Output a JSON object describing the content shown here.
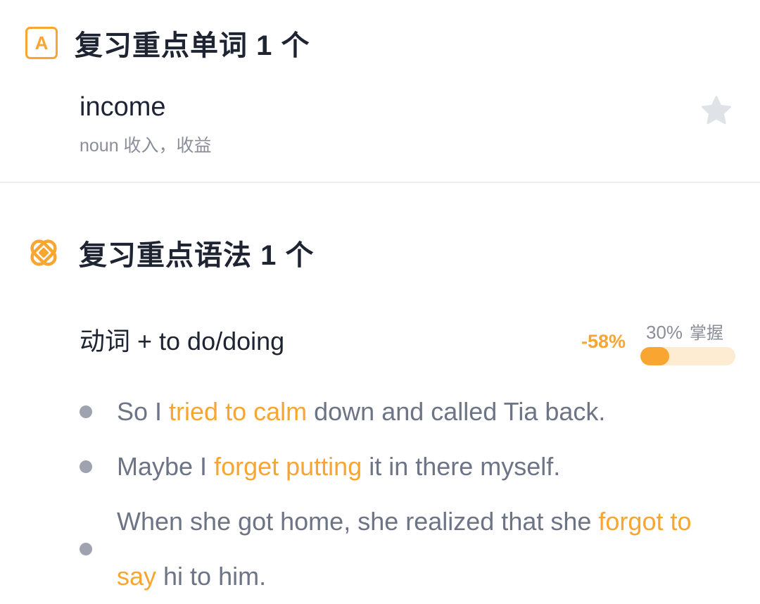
{
  "words_section": {
    "icon": "letter-a-icon",
    "icon_letter": "A",
    "title": "复习重点单词 1 个",
    "items": [
      {
        "term": "income",
        "definition": "noun 收入，收益",
        "starred": false
      }
    ]
  },
  "grammar_section": {
    "icon": "grammar-knot-icon",
    "title": "复习重点语法 1 个",
    "items": [
      {
        "title": "动词 + to do/doing",
        "mastery_delta": "-58%",
        "mastery_percent_label": "30%",
        "mastery_word": "掌握",
        "mastery_value": 0.3,
        "examples": [
          {
            "before": "So I ",
            "highlight": "tried to calm",
            "after": " down and called Tia back."
          },
          {
            "before": "Maybe I ",
            "highlight": "forget putting",
            "after": " it in there myself."
          },
          {
            "before": "When she got home, she realized that she ",
            "highlight": "forgot to say",
            "after": " hi to him."
          }
        ]
      }
    ]
  },
  "colors": {
    "accent": "#f8a531",
    "text_primary": "#1f2433",
    "text_secondary": "#6d7486",
    "text_muted": "#8a8e99",
    "star_inactive": "#dfe3e8",
    "progress_track": "#fdebd2",
    "divider": "#ebedf0"
  }
}
